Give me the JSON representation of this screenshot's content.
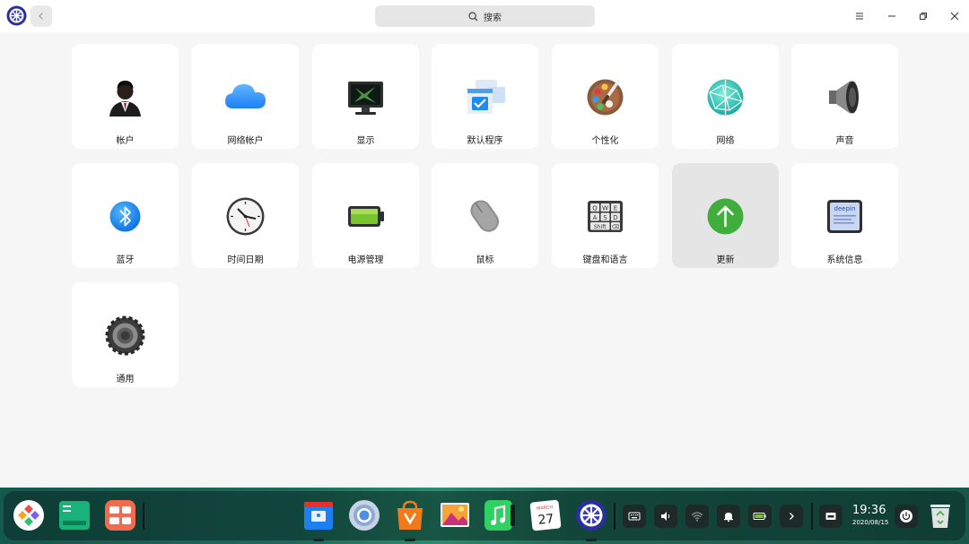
{
  "titlebar": {
    "search_label": "搜索"
  },
  "modules": [
    {
      "label": "帐户",
      "icon": "user-account-icon"
    },
    {
      "label": "网络帐户",
      "icon": "cloud-icon"
    },
    {
      "label": "显示",
      "icon": "monitor-icon"
    },
    {
      "label": "默认程序",
      "icon": "default-apps-icon"
    },
    {
      "label": "个性化",
      "icon": "palette-icon"
    },
    {
      "label": "网络",
      "icon": "network-icon"
    },
    {
      "label": "声音",
      "icon": "speaker-icon"
    },
    {
      "label": "蓝牙",
      "icon": "bluetooth-icon"
    },
    {
      "label": "时间日期",
      "icon": "clock-icon"
    },
    {
      "label": "电源管理",
      "icon": "battery-icon"
    },
    {
      "label": "鼠标",
      "icon": "mouse-icon"
    },
    {
      "label": "键盘和语言",
      "icon": "keyboard-icon"
    },
    {
      "label": "更新",
      "icon": "update-arrow-icon"
    },
    {
      "label": "系统信息",
      "icon": "system-info-icon"
    },
    {
      "label": "通用",
      "icon": "gear-icon"
    }
  ],
  "keyboard_keys": [
    "Q",
    "W",
    "E",
    "A",
    "S",
    "D",
    "Shift",
    "⌫"
  ],
  "system_info_brand": "deepin",
  "dock": {
    "calendar_month": "MARCH",
    "calendar_day": "27",
    "clock_time": "19:36",
    "clock_date": "2020/08/15"
  },
  "colors": {
    "accent_blue": "#1f7ff7",
    "update_green": "#3fae3c",
    "battery_green": "#7ac42f"
  }
}
